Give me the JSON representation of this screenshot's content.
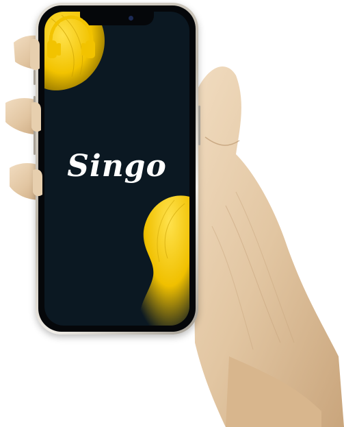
{
  "app": {
    "name": "Singo",
    "logo_icon": "headphones-icon"
  },
  "colors": {
    "screen_background": "#0b1822",
    "accent": "#f2c300",
    "wordmark": "#ffffff",
    "phone_frame": "#cfc9bf"
  }
}
